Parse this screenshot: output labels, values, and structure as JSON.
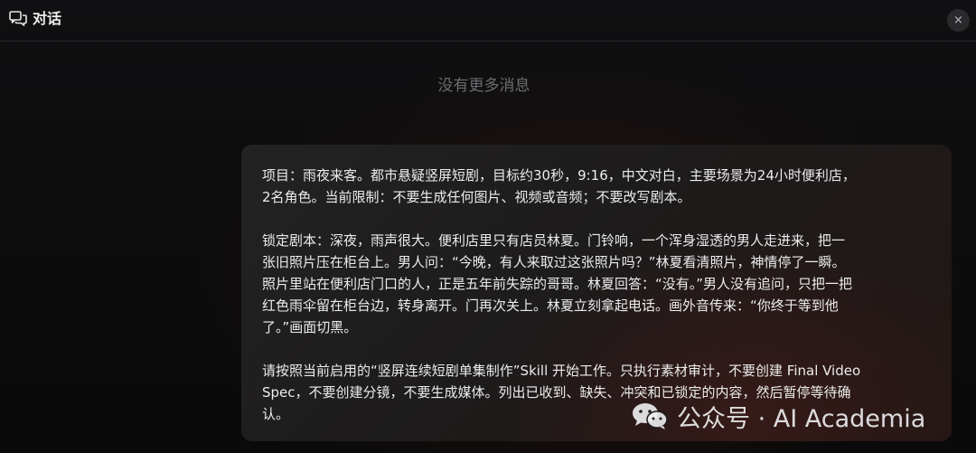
{
  "header": {
    "title": "对话",
    "icon": "chat-bubbles-icon",
    "close_icon": "close-icon",
    "close_glyph": "×"
  },
  "status": {
    "no_more_messages": "没有更多消息"
  },
  "message": {
    "paragraphs": [
      "项目：雨夜来客。都市悬疑竖屏短剧，目标约30秒，9:16，中文对白，主要场景为24小时便利店，\n2名角色。当前限制：不要生成任何图片、视频或音频；不要改写剧本。",
      "锁定剧本：深夜，雨声很大。便利店里只有店员林夏。门铃响，一个浑身湿透的男人走进来，把一\n张旧照片压在柜台上。男人问：“今晚，有人来取过这张照片吗？”林夏看清照片，神情停了一瞬。\n照片里站在便利店门口的人，正是五年前失踪的哥哥。林夏回答：“没有。”男人没有追问，只把一把\n红色雨伞留在柜台边，转身离开。门再次关上。林夏立刻拿起电话。画外音传来：“你终于等到他\n了。”画面切黑。",
      "请按照当前启用的“竖屏连续短剧单集制作”Skill 开始工作。只执行素材审计，不要创建 Final Video\nSpec，不要创建分镜，不要生成媒体。列出已收到、缺失、冲突和已锁定的内容，然后暂停等待确\n认。"
    ]
  },
  "watermark": {
    "text": "公众号 · AI Academia",
    "logo_icon": "wechat-logo-icon"
  }
}
